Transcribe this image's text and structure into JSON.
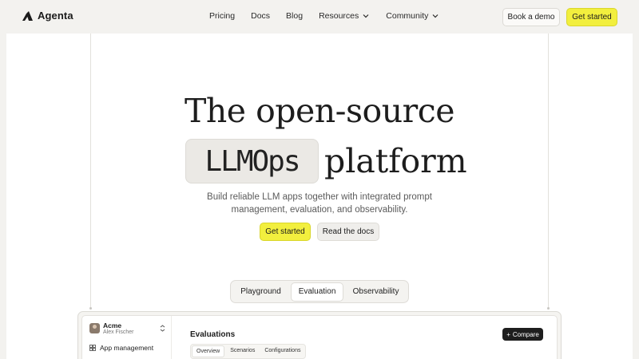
{
  "nav": {
    "brand": "Agenta",
    "links": [
      {
        "label": "Pricing"
      },
      {
        "label": "Docs"
      },
      {
        "label": "Blog"
      },
      {
        "label": "Resources",
        "dropdown": true
      },
      {
        "label": "Community",
        "dropdown": true
      }
    ],
    "book_demo": "Book a demo",
    "get_started": "Get started"
  },
  "hero": {
    "line1": "The open-source",
    "highlight": "LLMOps",
    "line2_rest": "platform",
    "subtitle_line1": "Build reliable LLM apps together with integrated prompt",
    "subtitle_line2": "management, evaluation, and observability.",
    "cta_primary": "Get started",
    "cta_secondary": "Read the docs"
  },
  "tabs": {
    "items": [
      "Playground",
      "Evaluation",
      "Observability"
    ],
    "active": "Evaluation"
  },
  "preview": {
    "workspace": "Acme",
    "user": "Alex Fischer",
    "sidebar_item": "App management",
    "title": "Evaluations",
    "compare_button": "Compare",
    "sub_tabs": [
      "Overview",
      "Scenarios",
      "Configurations"
    ],
    "active_sub_tab": "Overview"
  },
  "colors": {
    "accent_yellow": "#f2ef3e",
    "page_bg": "#f3f2ef",
    "dark_button": "#1e1e1e"
  }
}
